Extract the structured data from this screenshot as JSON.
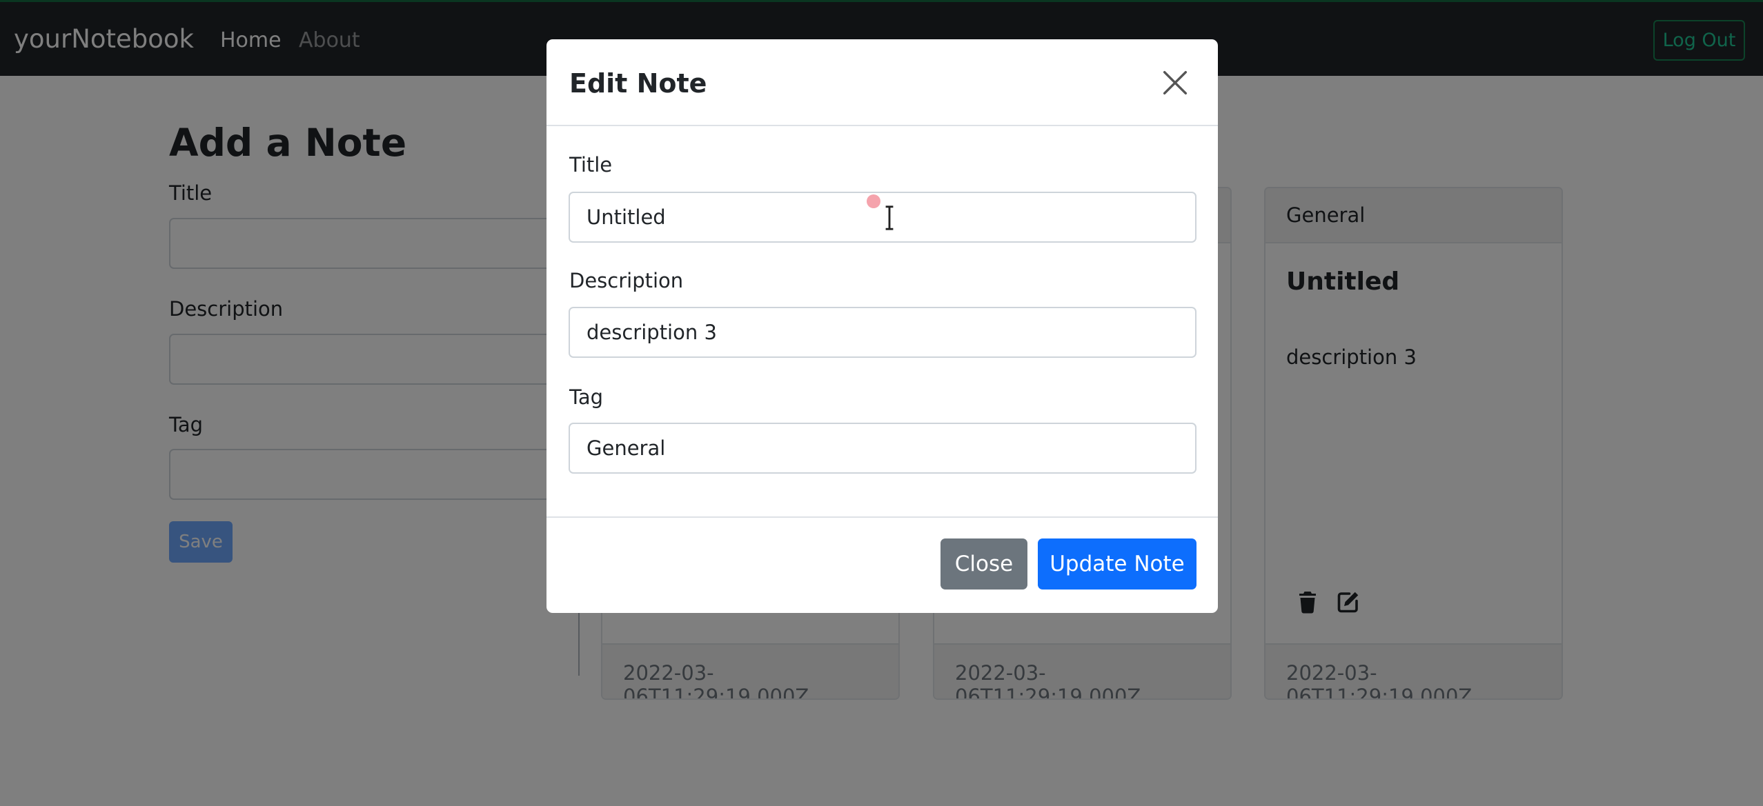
{
  "navbar": {
    "brand": "yourNotebook",
    "links": [
      "Home",
      "About"
    ],
    "logout_label": "Log Out"
  },
  "add_note": {
    "heading": "Add a Note",
    "title_label": "Title",
    "description_label": "Description",
    "tag_label": "Tag",
    "save_label": "Save"
  },
  "notes": [
    {
      "tag": "",
      "title": "",
      "description": "",
      "date": "2022-03-06T11:29:19.000Z"
    },
    {
      "tag": "",
      "title": "",
      "description": "",
      "date": "2022-03-06T11:29:19.000Z"
    },
    {
      "tag": "General",
      "title": "Untitled",
      "description": "description 3",
      "date": "2022-03-06T11:29:19.000Z"
    }
  ],
  "modal": {
    "title": "Edit Note",
    "fields": {
      "title": {
        "label": "Title",
        "value": "Untitled"
      },
      "description": {
        "label": "Description",
        "value": "description 3"
      },
      "tag": {
        "label": "Tag",
        "value": "General"
      }
    },
    "close_label": "Close",
    "update_label": "Update Note"
  },
  "icons": [
    "close-icon",
    "trash-icon",
    "edit-icon",
    "text-cursor-icon"
  ],
  "colors": {
    "navbar_bg": "#212529",
    "primary": "#0d6efd",
    "secondary": "#6c757d",
    "success_outline": "#198754",
    "backdrop": "rgba(0,0,0,0.5)"
  }
}
